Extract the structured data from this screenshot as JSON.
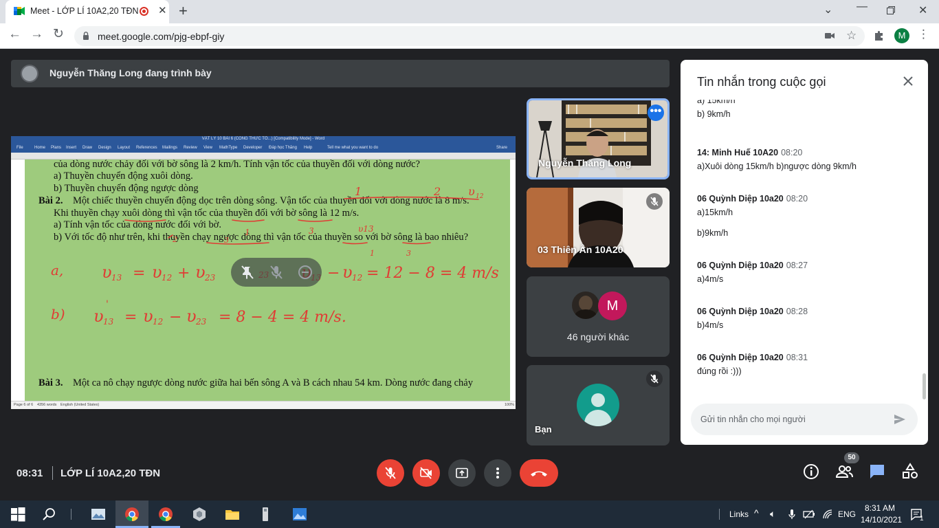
{
  "browser": {
    "tab_title": "Meet - LỚP LÍ 10A2,20 TĐN",
    "tab_close": "✕",
    "new_tab": "+",
    "url": "meet.google.com/pjg-ebpf-giy",
    "profile_initial": "M"
  },
  "meet": {
    "presenter_label": "Nguyễn Thăng Long đang trình bày",
    "document": {
      "window_title": "VẬT LÝ 10 BÀI 6 (CÔNG THỨC TỔ...) [Compatibility Mode] - Word",
      "ribbon_tabs": [
        "File",
        "Home",
        "Plans",
        "Insert",
        "Draw",
        "Design",
        "Layout",
        "References",
        "Mailings",
        "Review",
        "View",
        "MathType",
        "Developer",
        "Đáp học Thăng",
        "Help",
        "Tell me what you want to do",
        "Share"
      ],
      "lines": [
        "của dòng nước chảy đối với bờ sông là 2 km/h. Tính vận tốc của thuyền đối với dòng nước?",
        "a)   Thuyền chuyển động xuôi dòng.",
        "b)   Thuyền chuyển động ngược dòng",
        "Bài 2.",
        "Một chiếc thuyền chuyển động dọc trên dòng sông. Vận tốc của thuyền đối với dòng nước là 8 m/s.",
        "Khi thuyền chạy xuôi dòng thì vận tốc của thuyền đối với bờ sông là 12 m/s.",
        "a)   Tính vận tốc của dòng nước đối với bờ.",
        "b)   Với tốc độ như trên, khi thuyền chạy ngược dòng thì vận tốc của thuyền so với bờ sông là bao nhiêu?",
        "Bài 3.",
        "Một ca nô chạy ngược dòng nước giữa hai bến sông A và B cách nhau 54 km. Dòng nước đang chảy"
      ],
      "status_items": [
        "Page 6 of 6",
        "4356 words",
        "English (United States)",
        "100%"
      ]
    },
    "tiles": {
      "presenter_name": "Nguyễn Thăng Long",
      "student_name": "03 Thiên Ân 10A20",
      "others_label": "46 người khác",
      "others_initial": "M",
      "self_name": "Bạn"
    },
    "chat": {
      "heading": "Tin nhắn trong cuộc gọi",
      "messages": [
        {
          "sender": "",
          "time": "",
          "lines": [
            "a) 15km/h",
            "b) 9km/h"
          ]
        },
        {
          "sender": "14: Minh Huế 10A20",
          "time": "08:20",
          "lines": [
            "a)Xuôi dòng 15km/h  b)ngược dòng 9km/h"
          ]
        },
        {
          "sender": "06 Quỳnh Diệp 10a20",
          "time": "08:20",
          "lines": [
            "a)15km/h",
            "b)9km/h"
          ]
        },
        {
          "sender": "06 Quỳnh Diệp 10a20",
          "time": "08:27",
          "lines": [
            "a)4m/s"
          ]
        },
        {
          "sender": "06 Quỳnh Diệp 10a20",
          "time": "08:28",
          "lines": [
            "b)4m/s"
          ]
        },
        {
          "sender": "06 Quỳnh Diệp 10a20",
          "time": "08:31",
          "lines": [
            "đúng rồi :)))"
          ]
        }
      ],
      "input_placeholder": "Gửi tin nhắn cho mọi người"
    },
    "bottom": {
      "clock": "08:31",
      "meeting_name": "LỚP LÍ 10A2,20 TĐN",
      "participant_count": "50"
    }
  },
  "taskbar": {
    "links": "Links",
    "language": "ENG",
    "time": "8:31 AM",
    "date": "14/10/2021",
    "notifications": "1"
  }
}
